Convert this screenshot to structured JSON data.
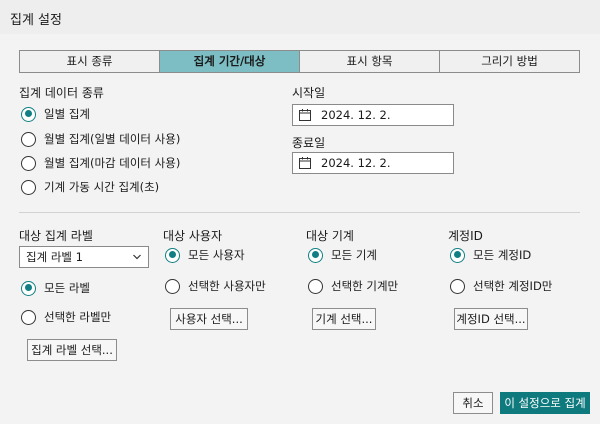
{
  "window": {
    "title": "집계 설정"
  },
  "tabs": [
    {
      "label": "표시 종류",
      "active": false
    },
    {
      "label": "집계 기간/대상",
      "active": true
    },
    {
      "label": "표시 항목",
      "active": false
    },
    {
      "label": "그리기 방법",
      "active": false
    }
  ],
  "data_type": {
    "heading": "집계 데이터 종류",
    "options": [
      {
        "label": "일별 집계",
        "selected": true
      },
      {
        "label": "월별 집계(일별 데이터 사용)",
        "selected": false
      },
      {
        "label": "월별 집계(마감 데이터 사용)",
        "selected": false
      },
      {
        "label": "기계 가동 시간 집계(초)",
        "selected": false
      }
    ]
  },
  "start_date": {
    "label": "시작일",
    "value": "2024. 12. 2."
  },
  "end_date": {
    "label": "종료일",
    "value": "2024. 12. 2."
  },
  "target_label": {
    "heading": "대상 집계 라벨",
    "select_value": "집계 라벨 1",
    "options": [
      {
        "label": "모든 라벨",
        "selected": true
      },
      {
        "label": "선택한 라벨만",
        "selected": false
      }
    ],
    "button": "집계 라벨 선택..."
  },
  "target_user": {
    "heading": "대상 사용자",
    "options": [
      {
        "label": "모든 사용자",
        "selected": true
      },
      {
        "label": "선택한 사용자만",
        "selected": false
      }
    ],
    "button": "사용자 선택..."
  },
  "target_machine": {
    "heading": "대상 기계",
    "options": [
      {
        "label": "모든 기계",
        "selected": true
      },
      {
        "label": "선택한 기계만",
        "selected": false
      }
    ],
    "button": "기계 선택..."
  },
  "account": {
    "heading": "계정ID",
    "options": [
      {
        "label": "모든 계정ID",
        "selected": true
      },
      {
        "label": "선택한 계정ID만",
        "selected": false
      }
    ],
    "button": "계정ID 선택..."
  },
  "footer": {
    "cancel": "취소",
    "apply": "이 설정으로 집계"
  },
  "colors": {
    "accent": "#0e7a7e",
    "tab_active": "#7cbec3",
    "background": "#f3f3f3"
  },
  "icons": {
    "date": "calendar-icon",
    "select": "chevron-down-icon"
  }
}
